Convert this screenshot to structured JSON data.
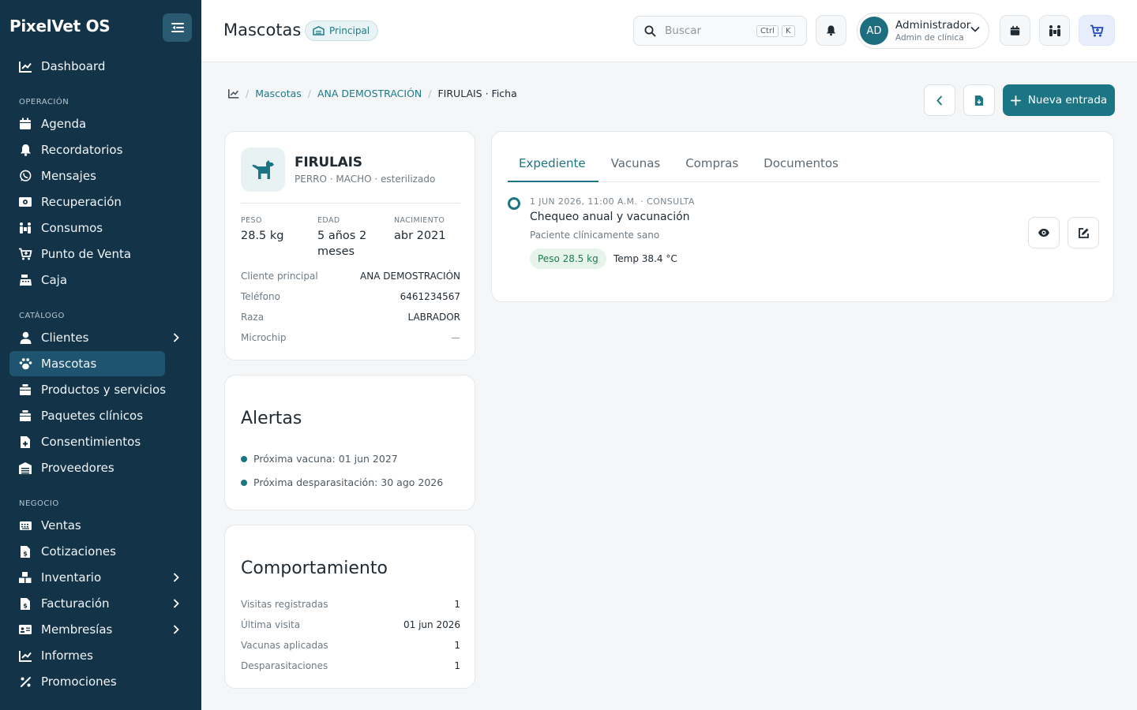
{
  "app": {
    "brand": "PixelVet OS"
  },
  "sidebar": {
    "top_item": {
      "label": "Dashboard",
      "icon": "chart-line-icon"
    },
    "sections": {
      "operacion": "OPERACIÓN",
      "catalogo": "CATÁLOGO",
      "negocio": "NEGOCIO"
    },
    "items": [
      {
        "label": "Agenda",
        "icon": "calendar-icon"
      },
      {
        "label": "Recordatorios",
        "icon": "bell-icon"
      },
      {
        "label": "Mensajes",
        "icon": "whatsapp-icon"
      },
      {
        "label": "Recuperación",
        "icon": "money-bill-icon"
      },
      {
        "label": "Consumos",
        "icon": "people-carry-icon"
      },
      {
        "label": "Punto de Venta",
        "icon": "cart-icon"
      },
      {
        "label": "Caja",
        "icon": "cash-register-icon"
      },
      {
        "label": "Clientes",
        "icon": "user-icon"
      },
      {
        "label": "Mascotas",
        "icon": "paw-icon"
      },
      {
        "label": "Productos y servicios",
        "icon": "box-icon"
      },
      {
        "label": "Paquetes clínicos",
        "icon": "package-icon"
      },
      {
        "label": "Consentimientos",
        "icon": "file-medical-icon"
      },
      {
        "label": "Proveedores",
        "icon": "warehouse-icon"
      },
      {
        "label": "Ventas",
        "icon": "register-icon"
      },
      {
        "label": "Cotizaciones",
        "icon": "file-invoice-icon"
      },
      {
        "label": "Inventario",
        "icon": "boxes-icon"
      },
      {
        "label": "Facturación",
        "icon": "invoice-dollar-icon"
      },
      {
        "label": "Membresías",
        "icon": "id-card-icon"
      },
      {
        "label": "Informes",
        "icon": "chart-line-icon"
      },
      {
        "label": "Promociones",
        "icon": "percent-icon"
      }
    ]
  },
  "topbar": {
    "title": "Mascotas",
    "branch_badge": "Principal",
    "search_placeholder": "Buscar",
    "kbd_ctrl": "Ctrl",
    "kbd_k": "K",
    "user": {
      "initials": "AD",
      "name": "Administrador",
      "role": "Admin de clínica"
    }
  },
  "breadcrumb": {
    "mascotas": "Mascotas",
    "client": "ANA DEMOSTRACIÓN",
    "current": "FIRULAIS · Ficha"
  },
  "actions": {
    "new_entry": "Nueva entrada"
  },
  "pet": {
    "name": "FIRULAIS",
    "meta": "PERRO · MACHO · esterilizado",
    "stats": [
      {
        "label": "PESO",
        "value": "28.5 kg"
      },
      {
        "label": "EDAD",
        "value": "5 años 2 meses"
      },
      {
        "label": "NACIMIENTO",
        "value": "abr 2021"
      }
    ],
    "details": [
      {
        "k": "Cliente principal",
        "v": "ANA DEMOSTRACIÓN"
      },
      {
        "k": "Teléfono",
        "v": "6461234567"
      },
      {
        "k": "Raza",
        "v": "LABRADOR"
      },
      {
        "k": "Microchip",
        "v": "—"
      }
    ]
  },
  "alerts": {
    "title": "Alertas",
    "items": [
      "Próxima vacuna: 01 jun 2027",
      "Próxima desparasitación: 30 ago 2026"
    ]
  },
  "behavior": {
    "title": "Comportamiento",
    "rows": [
      {
        "k": "Visitas registradas",
        "v": "1"
      },
      {
        "k": "Última visita",
        "v": "01 jun 2026"
      },
      {
        "k": "Vacunas aplicadas",
        "v": "1"
      },
      {
        "k": "Desparasitaciones",
        "v": "1"
      }
    ]
  },
  "record": {
    "tabs": [
      "Expediente",
      "Vacunas",
      "Compras",
      "Documentos"
    ],
    "entry": {
      "date": "1 JUN 2026, 11:00 A.M. · CONSULTA",
      "title": "Chequeo anual y vacunación",
      "desc": "Paciente clínicamente sano",
      "peso_chip": "Peso 28.5 kg",
      "temp_chip": "Temp 38.4 °C"
    }
  },
  "colors": {
    "sidebar": "#133448",
    "accent": "#1c7584",
    "active_item": "#1e5470"
  }
}
